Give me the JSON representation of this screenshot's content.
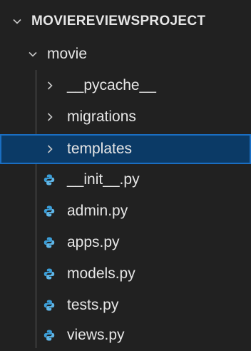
{
  "explorer": {
    "project_title": "MOVIEREVIEWSPROJECT",
    "folder": "movie",
    "subfolders": [
      "__pycache__",
      "migrations",
      "templates"
    ],
    "files": [
      "__init__.py",
      "admin.py",
      "apps.py",
      "models.py",
      "tests.py",
      "views.py"
    ],
    "selected_item": "templates"
  },
  "colors": {
    "background": "#212121",
    "selection": "#0b3a66",
    "selection_border": "#1a6ec2",
    "python_icon": "#3b9ed8"
  },
  "icons": {
    "expanded": "chevron-down-icon",
    "collapsed": "chevron-right-icon",
    "file": "python-file-icon"
  }
}
